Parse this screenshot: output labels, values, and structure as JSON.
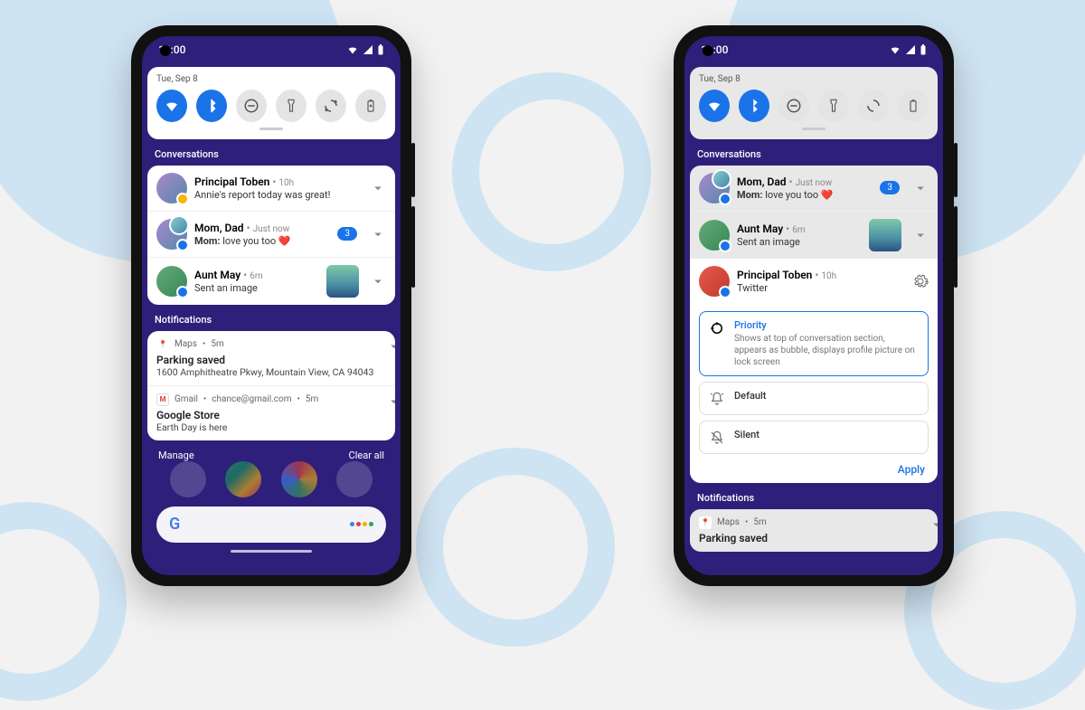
{
  "status": {
    "time": "11:00"
  },
  "qs": {
    "date": "Tue, Sep 8"
  },
  "sections": {
    "conversations": "Conversations",
    "notifications": "Notifications"
  },
  "left": {
    "conv": [
      {
        "name": "Principal Toben",
        "time": "10h",
        "text": "Annie's report today was great!"
      },
      {
        "name": "Mom, Dad",
        "time": "Just now",
        "prefix": "Mom:",
        "text": "love you too ❤️",
        "badge": "3"
      },
      {
        "name": "Aunt May",
        "time": "6m",
        "text": "Sent an image"
      }
    ],
    "notifs": {
      "maps": {
        "app": "Maps",
        "time": "5m",
        "title": "Parking saved",
        "sub": "1600 Amphitheatre Pkwy, Mountain View, CA 94043"
      },
      "gmail": {
        "app": "Gmail",
        "account": "chance@gmail.com",
        "time": "5m",
        "title": "Google Store",
        "sub": "Earth Day is here"
      }
    },
    "footer": {
      "manage": "Manage",
      "clear": "Clear all"
    }
  },
  "right": {
    "conv": [
      {
        "name": "Mom, Dad",
        "time": "Just now",
        "prefix": "Mom:",
        "text": "love you too ❤️",
        "badge": "3"
      },
      {
        "name": "Aunt May",
        "time": "6m",
        "text": "Sent an image"
      },
      {
        "name": "Principal Toben",
        "time": "10h",
        "text": "Twitter"
      }
    ],
    "options": {
      "priority": {
        "label": "Priority",
        "desc": "Shows at top of conversation section, appears as bubble, displays profile picture on lock screen"
      },
      "default": {
        "label": "Default"
      },
      "silent": {
        "label": "Silent"
      },
      "apply": "Apply"
    },
    "notifs": {
      "maps": {
        "app": "Maps",
        "time": "5m",
        "title": "Parking saved"
      }
    }
  }
}
